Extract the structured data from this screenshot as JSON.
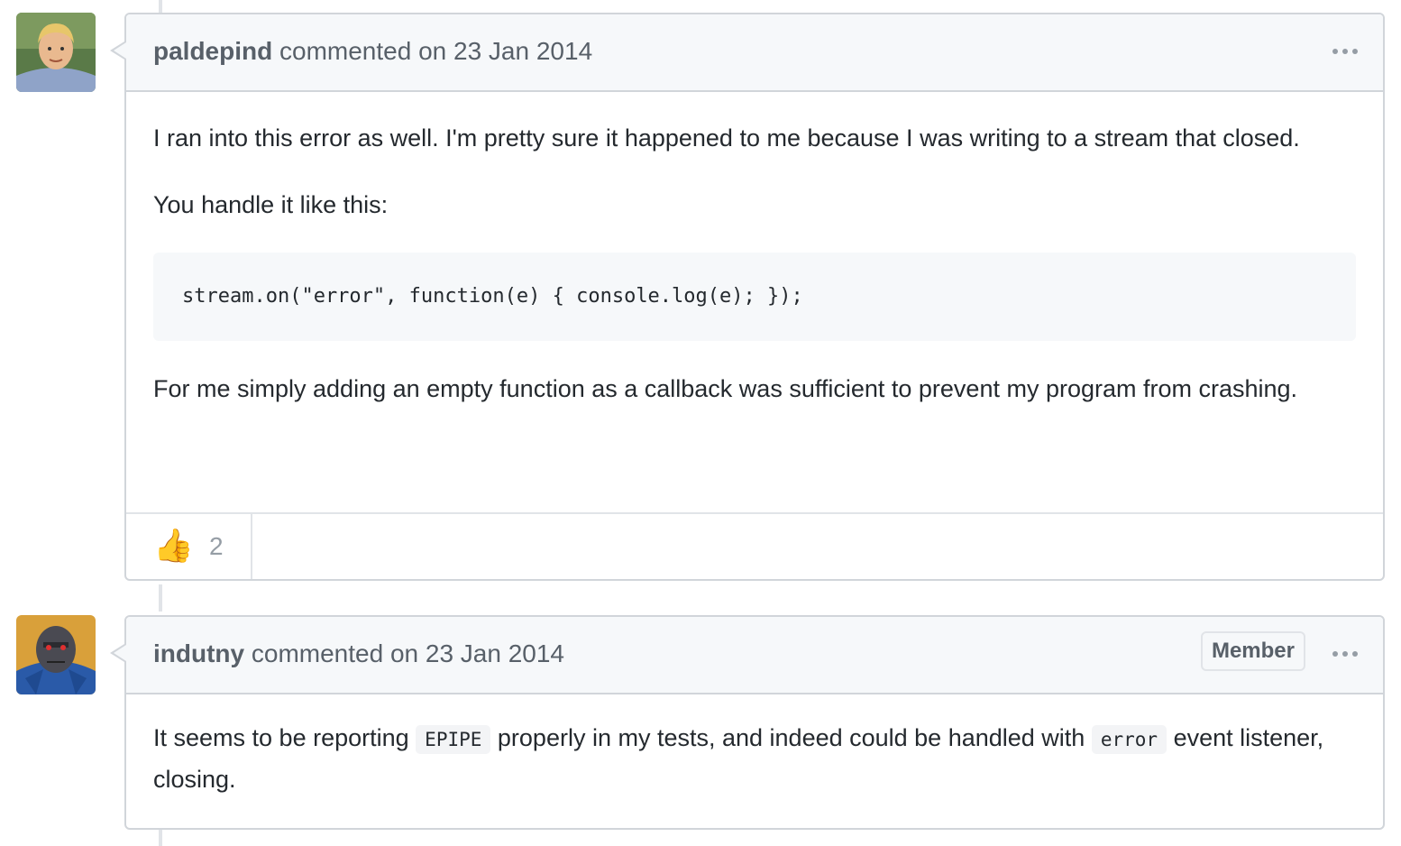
{
  "comments": [
    {
      "author": "paldepind",
      "action": "commented on 23 Jan 2014",
      "paragraphs": [
        "I ran into this error as well. I'm pretty sure it happened to me because I was writing to a stream that closed.",
        "You handle it like this:",
        "For me simply adding an empty function as a callback was sufficient to prevent my program from crashing."
      ],
      "code": "stream.on(\"error\", function(e) { console.log(e); });",
      "reaction": {
        "emoji": "👍",
        "count": "2"
      }
    },
    {
      "author": "indutny",
      "action": "commented on 23 Jan 2014",
      "badge": "Member",
      "body": {
        "part1": "It seems to be reporting",
        "code1": "EPIPE",
        "part2": "properly in my tests, and indeed could be handled with",
        "code2": "error",
        "part3": "event listener, closing."
      }
    }
  ],
  "icons": {
    "menu": "kebab-horizontal-icon",
    "reaction": "thumbs-up-icon"
  },
  "colors": {
    "header_bg": "#f6f8fa",
    "border": "#d1d5da",
    "muted_text": "#586069"
  }
}
